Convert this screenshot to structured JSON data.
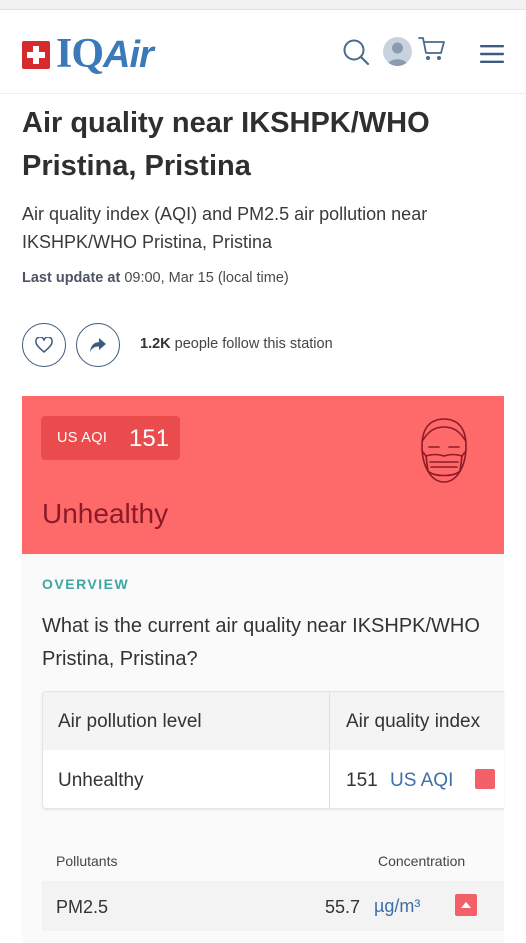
{
  "header": {
    "logo_text_iq": "IQ",
    "logo_text_air": "Air",
    "icons": [
      "search-icon",
      "avatar",
      "cart-icon",
      "menu-icon"
    ]
  },
  "page": {
    "title": "Air quality near IKSHPK/WHO Pristina, Pristina",
    "subtitle": "Air quality index (AQI) and PM2.5 air pollution near IKSHPK/WHO Pristina, Pristina",
    "last_update_label": "Last update at",
    "last_update_value": "09:00, Mar 15 (local time)",
    "followers_count": "1.2K",
    "followers_text": "people follow this station"
  },
  "aqi_card": {
    "badge_label": "US AQI",
    "badge_value": "151",
    "status": "Unhealthy",
    "card_color": "#fe6a69",
    "badge_color": "#ea4c4d",
    "status_color": "#8c1b27"
  },
  "overview": {
    "section_label": "OVERVIEW",
    "question": "What is the current air quality near IKSHPK/WHO Pristina, Pristina?",
    "table": {
      "col1_header": "Air pollution level",
      "col2_header": "Air quality index",
      "level": "Unhealthy",
      "index_value": "151",
      "index_unit": "US AQI"
    },
    "pollutants": {
      "col1_header": "Pollutants",
      "col2_header": "Concentration",
      "rows": [
        {
          "name": "PM2.5",
          "value": "55.7",
          "unit": "µg/m³"
        }
      ]
    }
  },
  "colors": {
    "brand_blue": "#3a7ab8",
    "accent_teal": "#3fa6a3",
    "unit_blue": "#3d6fa8",
    "alert_red": "#f4606a"
  }
}
